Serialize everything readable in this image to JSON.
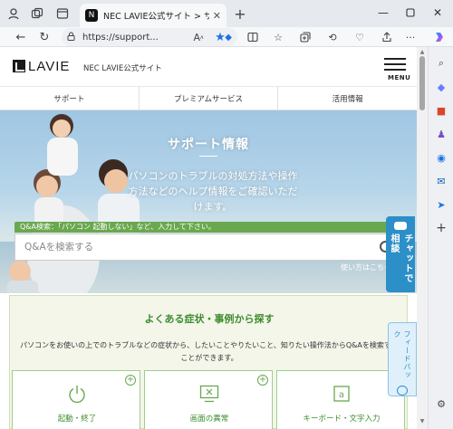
{
  "browser": {
    "tab_title": "NEC LAVIE公式サイト > サービス＆サポート",
    "url": "https://support...",
    "colors": {
      "accent": "#1a73e8",
      "tabbar": "#e6e9ee"
    }
  },
  "site": {
    "logo_text": "LAVIE",
    "site_name": "NEC LAVIE公式サイト",
    "menu_label": "MENU"
  },
  "gnav": [
    {
      "label": "サポート"
    },
    {
      "label": "プレミアムサービス"
    },
    {
      "label": "活用情報"
    }
  ],
  "hero": {
    "title": "サポート情報",
    "description": "パソコンのトラブルの対処方法や操作方法などのヘルプ情報をご確認いただけます。",
    "qa_hint": "Q&A検索：「パソコン 起動しない」など、入力して下さい。",
    "search_placeholder": "Q&Aを検索する",
    "howto_label": "使い方はこちら",
    "howto_icon_text": "?"
  },
  "chat_tab": {
    "label": "チャットで相談"
  },
  "feedback_tab": {
    "label": "フィードバック"
  },
  "faq": {
    "title": "よくある症状・事例から探す",
    "description": "パソコンをお使いの上でのトラブルなどの症状から、したいことやりたいこと、知りたい操作法からQ&Aを検索することができます。",
    "categories": [
      {
        "label": "起動・終了",
        "icon": "power-icon"
      },
      {
        "label": "画面の異常",
        "icon": "monitor-icon"
      },
      {
        "label": "キーボード・文字入力",
        "icon": "keyboard-icon"
      }
    ],
    "colors": {
      "green": "#3f8c2f",
      "bg": "#f3f6e9"
    }
  }
}
